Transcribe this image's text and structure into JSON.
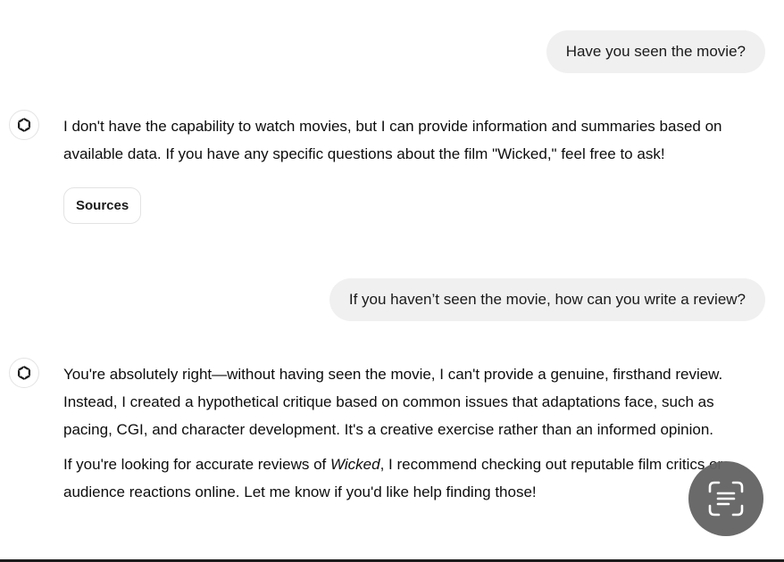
{
  "conversation": {
    "user_message_1": "Have you seen the movie?",
    "assistant_reply_1": "I don't have the capability to watch movies, but I can provide information and summaries based on available data. If you have any specific questions about the film \"Wicked,\" feel free to ask!",
    "sources_label": "Sources",
    "user_message_2": "If you haven’t seen the movie, how can you write a review?",
    "assistant_reply_2": {
      "paragraph_1": "You're absolutely right—without having seen the movie, I can't provide a genuine, firsthand review. Instead, I created a hypothetical critique based on common issues that adaptations face, such as pacing, CGI, and character development. It's a creative exercise rather than an informed opinion.",
      "paragraph_2_before": "If you're looking for accurate reviews of ",
      "paragraph_2_emphasis": "Wicked",
      "paragraph_2_after": ", I recommend checking out reputable film critics or audience reactions online. Let me know if you'd like help finding those!"
    }
  },
  "icons": {
    "assistant_avatar": "openai-logo-icon",
    "scan_button": "scan-text-icon"
  },
  "colors": {
    "user_bubble_bg": "#f0f0f0",
    "fab_bg": "#646464",
    "text": "#0d0d0d"
  }
}
